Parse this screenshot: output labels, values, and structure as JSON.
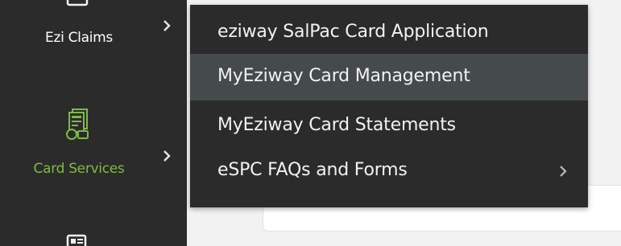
{
  "sidebar": {
    "items": [
      {
        "label": "Ezi Claims",
        "icon": "claims-icon",
        "label_color": "#ffffff"
      },
      {
        "label": "Card Services",
        "icon": "card-services-icon",
        "label_color": "#7dbb42",
        "active": true
      },
      {
        "label": "",
        "icon": "document-icon"
      }
    ]
  },
  "flyout": {
    "items": [
      {
        "label": "eziway SalPac Card Application"
      },
      {
        "label": "MyEziway Card Management",
        "highlighted": true
      },
      {
        "label": "MyEziway Card Statements"
      },
      {
        "label": "eSPC FAQs and Forms",
        "has_submenu": true
      }
    ]
  },
  "colors": {
    "sidebar_bg": "#2b2b2b",
    "flyout_bg": "#2b2b2b",
    "highlight_bg": "#454a4d",
    "accent_green": "#7dbb42"
  }
}
